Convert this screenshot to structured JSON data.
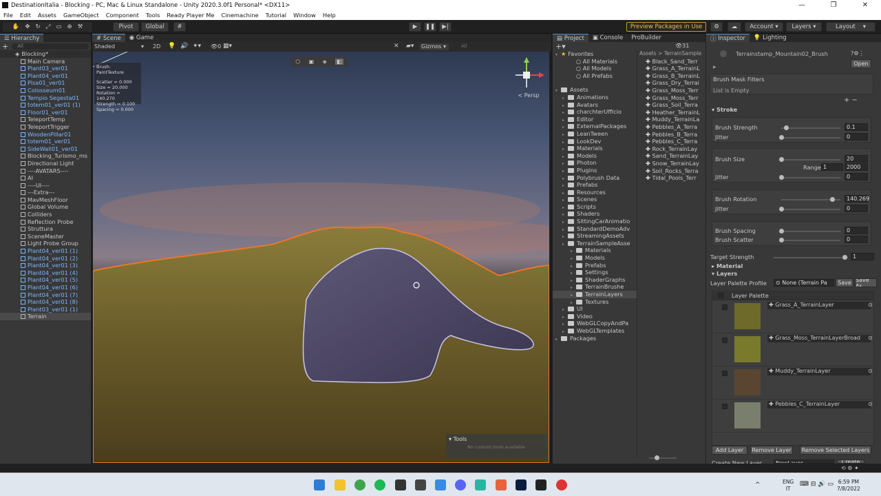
{
  "window": {
    "title": "DestinationItalia - Blocking - PC, Mac & Linux Standalone - Unity 2020.3.0f1 Personal* <DX11>",
    "min": "—",
    "max": "❐",
    "close": "✕"
  },
  "menu": [
    "File",
    "Edit",
    "Assets",
    "GameObject",
    "Component",
    "Tools",
    "Ready Player Me",
    "Cinemachine",
    "Tutorial",
    "Window",
    "Help"
  ],
  "toolbar": {
    "pivot": "Pivot",
    "global": "Global",
    "preview": "Preview Packages in Use",
    "account": "Account",
    "layers": "Layers",
    "layout": "Layout"
  },
  "hierarchy": {
    "tab": "Hierarchy",
    "search": "All",
    "scene": "Blocking*",
    "items": [
      {
        "t": "Main Camera",
        "b": false
      },
      {
        "t": "Plant03_ver01",
        "b": true
      },
      {
        "t": "Plant04_ver01",
        "b": true
      },
      {
        "t": "Pisa01_ver01",
        "b": true
      },
      {
        "t": "Colosseum01",
        "b": true
      },
      {
        "t": "Tempio Segesta01",
        "b": true
      },
      {
        "t": "totem01_ver01 (1)",
        "b": true
      },
      {
        "t": "Floor01_ver01",
        "b": true
      },
      {
        "t": "TeleportTemp",
        "b": false
      },
      {
        "t": "TeleportTrigger",
        "b": false
      },
      {
        "t": "WoodenPillar01",
        "b": true
      },
      {
        "t": "totem01_ver01",
        "b": true
      },
      {
        "t": "SideWall01_ver01",
        "b": true
      },
      {
        "t": "Blocking_Turismo_ms",
        "b": false
      },
      {
        "t": "Directional Light",
        "b": false
      },
      {
        "t": "----AVATARS----",
        "b": false
      },
      {
        "t": "AI",
        "b": false
      },
      {
        "t": "----UI----",
        "b": false
      },
      {
        "t": "---Extra---",
        "b": false
      },
      {
        "t": "MavMeshFloor",
        "b": false
      },
      {
        "t": "Global Volume",
        "b": false
      },
      {
        "t": "Colliders",
        "b": false
      },
      {
        "t": "Reflection Probe",
        "b": false
      },
      {
        "t": "Struttura",
        "b": false
      },
      {
        "t": "SceneMaster",
        "b": false
      },
      {
        "t": "Light Probe Group",
        "b": false
      },
      {
        "t": "Plant04_ver01 (1)",
        "b": true
      },
      {
        "t": "Plant04_ver01 (2)",
        "b": true
      },
      {
        "t": "Plant04_ver01 (3)",
        "b": true
      },
      {
        "t": "Plant04_ver01 (4)",
        "b": true
      },
      {
        "t": "Plant04_ver01 (5)",
        "b": true
      },
      {
        "t": "Plant04_ver01 (6)",
        "b": true
      },
      {
        "t": "Plant04_ver01 (7)",
        "b": true
      },
      {
        "t": "Plant04_ver01 (8)",
        "b": true
      },
      {
        "t": "Plant03_ver01 (1)",
        "b": true
      },
      {
        "t": "Terrain",
        "b": false
      }
    ]
  },
  "scene": {
    "tab_scene": "Scene",
    "tab_game": "Game",
    "shading": "Shaded",
    "dim": "2D",
    "gizmos": "Gizmos",
    "search": "All",
    "persp": "< Persp",
    "layers_count": "0",
    "brush_overlay": [
      "Brush: PaintTexture",
      "Scatter = 0.000",
      "Size = 20.000",
      "Rotation = 140.270",
      "Strength = 0.100",
      "Spacing = 0.000"
    ],
    "tools_title": "Tools",
    "tools_empty": "No custom tools available"
  },
  "project": {
    "tab_project": "Project",
    "tab_console": "Console",
    "tab_probuilder": "ProBuilder",
    "favorites": "Favorites",
    "fav_items": [
      "All Materials",
      "All Models",
      "All Prefabs"
    ],
    "assets": "Assets",
    "folders": [
      "Animations",
      "Avatars",
      "charchterUfficio",
      "Editor",
      "ExternalPackages",
      "LeanTween",
      "LookDev",
      "Materials",
      "Models",
      "Photon",
      "Plugins",
      "Polybrush Data",
      "Prefabs",
      "Resources",
      "Scenes",
      "Scripts",
      "Shaders",
      "SittingCarAnimatio",
      "StandardDemoAdv",
      "StreamingAssets",
      "TerrainSampleAsse"
    ],
    "subfolders": [
      "Materials",
      "Models",
      "Prefabs",
      "Settings",
      "ShaderGraphs",
      "TerrainBrushe",
      "TerrainLayers",
      "Textures"
    ],
    "after": [
      "UI",
      "Video",
      "WebGLCopyAndPa",
      "WebGLTemplates"
    ],
    "packages": "Packages",
    "breadcrumb": "Assets > TerrainSample",
    "count": "31",
    "files": [
      "Black_Sand_Terr",
      "Grass_A_TerrainL",
      "Grass_B_TerrainL",
      "Grass_Dry_Terrai",
      "Grass_Moss_Terr",
      "Grass_Moss_Terr",
      "Grass_Soil_Terra",
      "Heather_TerrainL",
      "Muddy_TerrainLa",
      "Pebbles_A_Terra",
      "Pebbles_B_Terra",
      "Pebbles_C_Terra",
      "Rock_TerrainLay",
      "Sand_TerrainLay",
      "Snow_TerrainLay",
      "Soil_Rocks_Terra",
      "Tidal_Pools_Terr"
    ]
  },
  "inspector": {
    "tab": "Inspector",
    "tab2": "Lighting",
    "title": "Terrainstamp_Mountain02_Brush",
    "open": "Open",
    "mask": "Brush Mask Filters",
    "empty": "List is Empty",
    "stroke": "Stroke",
    "strength_lbl": "Brush Strength",
    "strength": "0.1",
    "jitter": "Jitter",
    "j0": "0",
    "size_lbl": "Brush Size",
    "size": "20",
    "range": "Range:",
    "r1": "1",
    "r2": "2000",
    "rot_lbl": "Brush Rotation",
    "rot": "140.269",
    "spacing_lbl": "Brush Spacing",
    "scatter_lbl": "Brush Scatter",
    "target_lbl": "Target Strength",
    "target": "1",
    "material": "Material",
    "layers": "Layers",
    "palette_profile": "Layer Palette Profile",
    "none": "None (Terrain Pa",
    "save": "Save",
    "saveas": "Save As",
    "palette": "Layer Palette",
    "layer_items": [
      "Grass_A_TerrainLayer",
      "Grass_Moss_TerrainLayerBroad",
      "Muddy_TerrainLayer",
      "Pebbles_C_TerrainLayer"
    ],
    "add": "Add Layer",
    "remove": "Remove Layer",
    "remove_sel": "Remove Selected Layers",
    "create": "Create New Layer",
    "new_layer": "NewLayer",
    "create_btn": "Create"
  },
  "taskbar": {
    "lang1": "ENG",
    "lang2": "IT",
    "time": "6:59 PM",
    "date": "7/8/2022"
  }
}
